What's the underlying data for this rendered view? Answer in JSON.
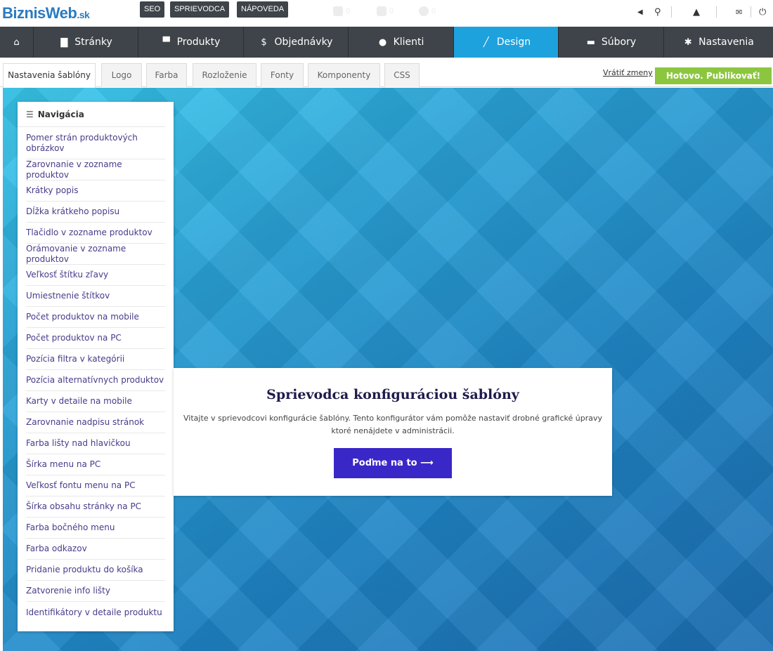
{
  "logo": {
    "main": "BiznisWeb",
    "suffix": ".sk"
  },
  "top_buttons": [
    "SEO",
    "SPRIEVODCA",
    "NÁPOVEDA"
  ],
  "ghost_counts": [
    "0",
    "0",
    "0"
  ],
  "nav": [
    {
      "label": "",
      "icon": "home-icon",
      "glyph": "⌂"
    },
    {
      "label": "Stránky",
      "icon": "page-icon",
      "glyph": "▇"
    },
    {
      "label": "Produkty",
      "icon": "cart-icon",
      "glyph": "▀"
    },
    {
      "label": "Objednávky",
      "icon": "dollar-icon",
      "glyph": "$"
    },
    {
      "label": "Klienti",
      "icon": "users-icon",
      "glyph": "●"
    },
    {
      "label": "Design",
      "icon": "brush-icon",
      "glyph": "╱"
    },
    {
      "label": "Súbory",
      "icon": "folder-icon",
      "glyph": "▬"
    },
    {
      "label": "Nastavenia",
      "icon": "gear-icon",
      "glyph": "✱"
    }
  ],
  "tabs": [
    "Nastavenia šablóny",
    "Logo",
    "Farba",
    "Rozloženie",
    "Fonty",
    "Komponenty",
    "CSS"
  ],
  "revert_label": "Vrátiť zmeny",
  "publish_label": "Hotovo. Publikovať!",
  "sidebar": {
    "title": "Navigácia",
    "items": [
      "Pomer strán produktových obrázkov",
      "Zarovnanie v zozname produktov",
      "Krátky popis",
      "Dĺžka krátkeho popisu",
      "Tlačidlo v zozname produktov",
      "Orámovanie v zozname produktov",
      "Veľkosť štítku zľavy",
      "Umiestnenie štítkov",
      "Počet produktov na mobile",
      "Počet produktov na PC",
      "Pozícia filtra v kategórii",
      "Pozícia alternatívnych produktov",
      "Karty v detaile na mobile",
      "Zarovnanie nadpisu stránok",
      "Farba lišty nad hlavičkou",
      "Šírka menu na PC",
      "Veľkosť fontu menu na PC",
      "Šírka obsahu stránky na PC",
      "Farba bočného menu",
      "Farba odkazov",
      "Pridanie produktu do košíka",
      "Zatvorenie info lišty",
      "Identifikátory v detaile produktu"
    ]
  },
  "wizard": {
    "title": "Sprievodca konfiguráciou šablóny",
    "text": "Vitajte v sprievodcovi konfigurácie šablóny. Tento konfigurátor vám pomôže nastaviť drobné grafické úpravy ktoré nenájdete v administrácii.",
    "button": "Poďme na to ⟶"
  },
  "colors": {
    "nav_bg": "#3e4449",
    "active": "#1ea2dd",
    "publish": "#8cc63f",
    "cta": "#3a27c8"
  }
}
